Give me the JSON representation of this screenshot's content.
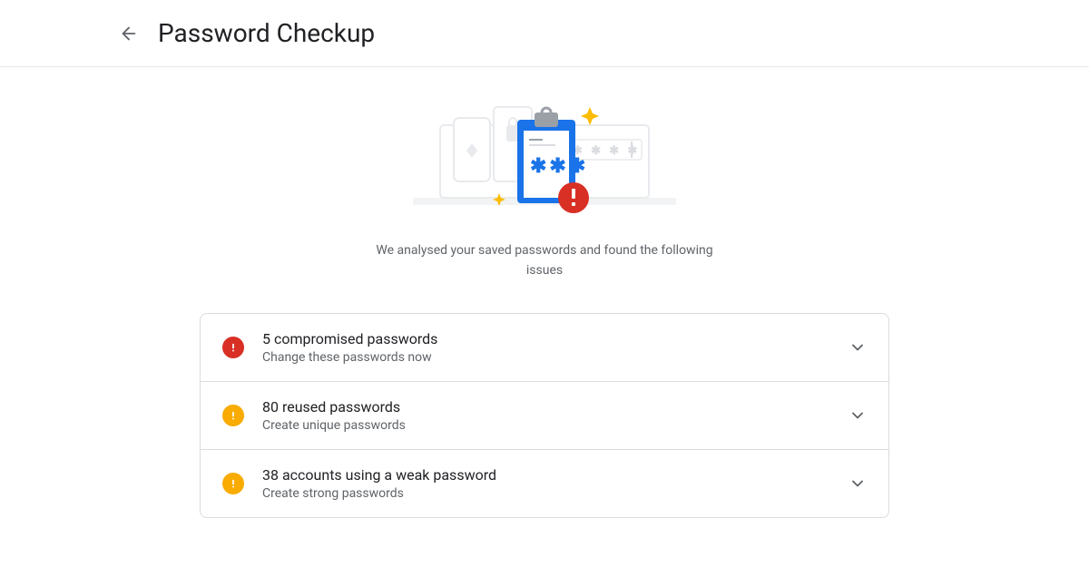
{
  "header": {
    "title": "Password Checkup"
  },
  "hero": {
    "summary": "We analysed your saved passwords and found the following issues"
  },
  "colors": {
    "danger": "#d93025",
    "warning": "#f9ab00",
    "accent_blue": "#1a73e8",
    "star_yellow": "#fbbc04"
  },
  "issues": [
    {
      "severity": "danger",
      "count": 5,
      "title": "5 compromised passwords",
      "subtitle": "Change these passwords now"
    },
    {
      "severity": "warning",
      "count": 80,
      "title": "80 reused passwords",
      "subtitle": "Create unique passwords"
    },
    {
      "severity": "warning",
      "count": 38,
      "title": "38 accounts using a weak password",
      "subtitle": "Create strong passwords"
    }
  ]
}
